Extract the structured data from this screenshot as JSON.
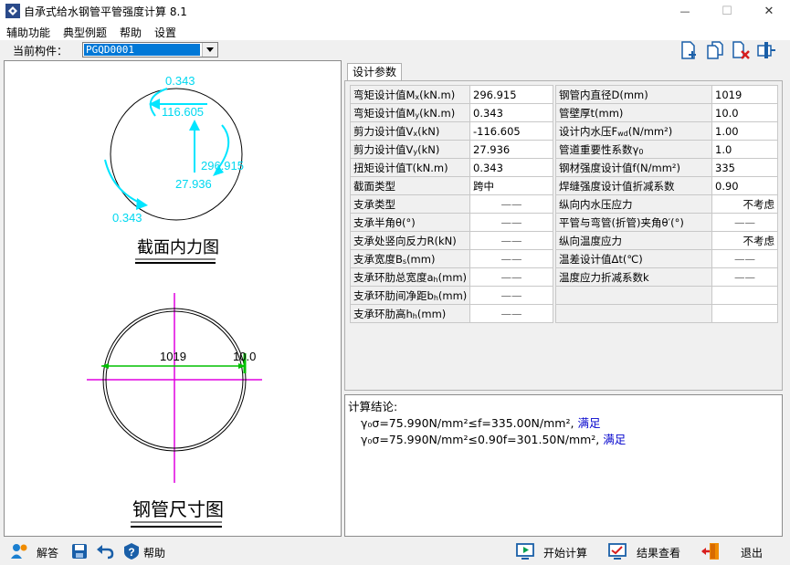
{
  "window": {
    "title": "自承式给水钢管平管强度计算 8.1",
    "minimize_glyph": "—",
    "maximize_glyph": "☐",
    "close_glyph": "✕"
  },
  "menu": {
    "items": [
      "辅助功能",
      "典型例题",
      "帮助",
      "设置"
    ]
  },
  "component": {
    "label": "当前构件：",
    "value": "PGQD0001"
  },
  "toolbar_icons": [
    "add-file-icon",
    "copy-file-icon",
    "delete-file-icon",
    "export-icon"
  ],
  "drawing": {
    "force_labels": {
      "top": "0.343",
      "center": "116.605",
      "right": "296.915",
      "bottom": "27.936",
      "left": "0.343"
    },
    "force_title": "截面内力图",
    "pipe_dia_label": "1019",
    "pipe_thk_label": "10.0",
    "pipe_title": "钢管尺寸图",
    "colors": {
      "force": "#00e5ff",
      "crosshair": "#e000e0",
      "dimension": "#00c000"
    }
  },
  "tabs": [
    "设计参数"
  ],
  "params_left": [
    {
      "label": "弯矩设计值M",
      "sub": "x",
      "unit": "(kN.m)",
      "value": "296.915"
    },
    {
      "label": "弯矩设计值M",
      "sub": "y",
      "unit": "(kN.m)",
      "value": "0.343"
    },
    {
      "label": "剪力设计值V",
      "sub": "x",
      "unit": "(kN)",
      "value": "-116.605"
    },
    {
      "label": "剪力设计值V",
      "sub": "y",
      "unit": "(kN)",
      "value": "27.936"
    },
    {
      "label": "扭矩设计值T",
      "sub": "",
      "unit": "(kN.m)",
      "value": "0.343"
    },
    {
      "label": "截面类型",
      "sub": "",
      "unit": "",
      "value": "跨中"
    },
    {
      "label": "支承类型",
      "sub": "",
      "unit": "",
      "value": "——"
    },
    {
      "label": "支承半角θ(°)",
      "sub": "",
      "unit": "",
      "value": "——"
    },
    {
      "label": "支承处竖向反力R",
      "sub": "",
      "unit": "(kN)",
      "value": "——"
    },
    {
      "label": "支承宽度B",
      "sub": "s",
      "unit": "(mm)",
      "value": "——"
    },
    {
      "label": "支承环肋总宽度a",
      "sub": "h",
      "unit": "(mm)",
      "value": "——"
    },
    {
      "label": "支承环肋间净距b",
      "sub": "h",
      "unit": "(mm)",
      "value": "——"
    },
    {
      "label": "支承环肋高h",
      "sub": "h",
      "unit": "(mm)",
      "value": "——"
    }
  ],
  "params_right": [
    {
      "label": "钢管内直径D",
      "sub": "",
      "unit": "(mm)",
      "value": "1019"
    },
    {
      "label": "管壁厚t",
      "sub": "",
      "unit": "(mm)",
      "value": "10.0"
    },
    {
      "label": "设计内水压F",
      "sub": "wd",
      "unit": "(N/mm²)",
      "value": "1.00"
    },
    {
      "label": "管道重要性系数γ",
      "sub": "0",
      "unit": "",
      "value": "1.0"
    },
    {
      "label": "钢材强度设计值f",
      "sub": "",
      "unit": "(N/mm²)",
      "value": "335"
    },
    {
      "label": "焊缝强度设计值折减系数",
      "sub": "",
      "unit": "",
      "value": "0.90"
    },
    {
      "label": "纵向内水压应力",
      "sub": "",
      "unit": "",
      "value": "不考虑"
    },
    {
      "label": "平管与弯管(折管)夹角θ′(°)",
      "sub": "",
      "unit": "",
      "value": "——"
    },
    {
      "label": "纵向温度应力",
      "sub": "",
      "unit": "",
      "value": "不考虑"
    },
    {
      "label": "温差设计值Δt(℃)",
      "sub": "",
      "unit": "",
      "value": "——"
    },
    {
      "label": "温度应力折减系数k",
      "sub": "",
      "unit": "",
      "value": "——"
    },
    {
      "label": "",
      "sub": "",
      "unit": "",
      "value": ""
    },
    {
      "label": "",
      "sub": "",
      "unit": "",
      "value": ""
    }
  ],
  "result": {
    "title": "计算结论:",
    "lines": [
      {
        "formula": "γ₀σ=75.990N/mm²≤f=335.00N/mm²,",
        "status": "满足"
      },
      {
        "formula": "γ₀σ=75.990N/mm²≤0.90f=301.50N/mm²,",
        "status": "满足"
      }
    ]
  },
  "bottom": {
    "answer": "解答",
    "help": "帮助",
    "start": "开始计算",
    "view": "结果查看",
    "exit": "退出"
  }
}
